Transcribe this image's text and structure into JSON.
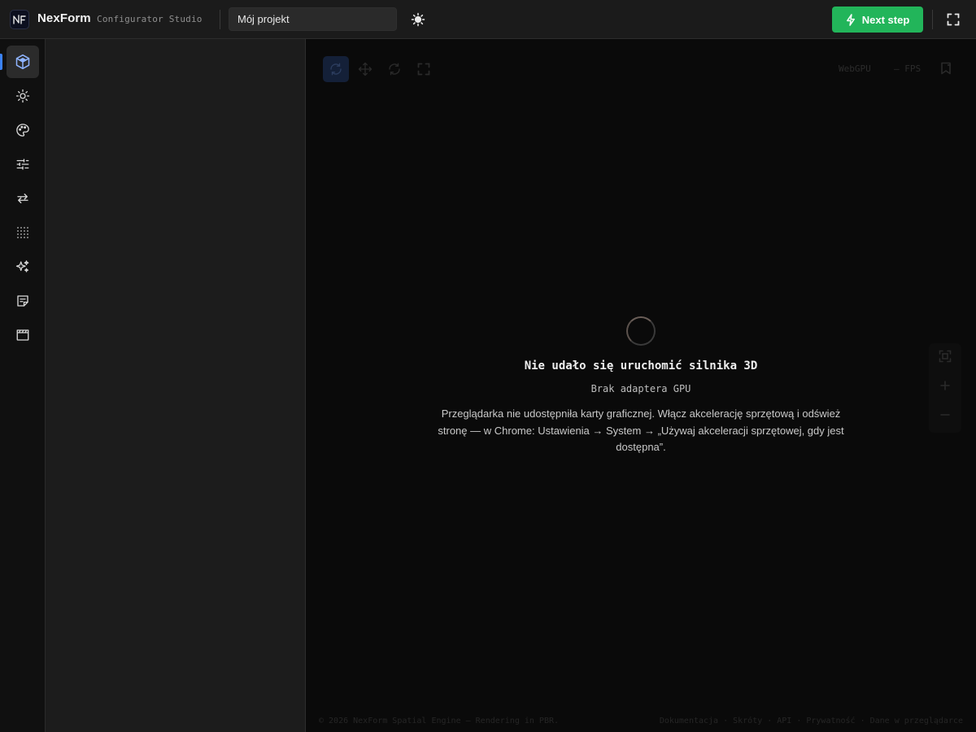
{
  "header": {
    "brand": "NexForm",
    "subtitle": "Configurator Studio",
    "project_value": "Mój projekt",
    "next_label": "Next step"
  },
  "rail": {
    "items": [
      {
        "id": "model",
        "icon": "cube-icon",
        "active": true
      },
      {
        "id": "lighting",
        "icon": "sun-icon"
      },
      {
        "id": "materials",
        "icon": "palette-icon"
      },
      {
        "id": "adjust",
        "icon": "sliders-icon"
      },
      {
        "id": "transform",
        "icon": "swap-arrows-icon"
      },
      {
        "id": "grid",
        "icon": "dot-grid-icon"
      },
      {
        "id": "effects",
        "icon": "sparkles-icon"
      },
      {
        "id": "notes",
        "icon": "note-icon"
      },
      {
        "id": "animation",
        "icon": "clapperboard-icon"
      }
    ]
  },
  "viewport": {
    "badges": {
      "renderer": "WebGPU",
      "fps": "— FPS"
    },
    "error": {
      "title": "Nie udało się uruchomić silnika 3D",
      "subtitle": "Brak adaptera GPU",
      "body": "Przeglądarka nie udostępniła karty graficznej. Włącz akcelerację sprzętową i odśwież stronę — w Chrome: Ustawienia → System → „Używaj akceleracji sprzętowej, gdy jest dostępna”."
    },
    "footer": {
      "copyright": "© 2026 NexForm Spatial Engine — Rendering in PBR.",
      "links": [
        "Dokumentacja",
        "Skróty",
        "API",
        "Prywatność",
        "Dane w przeglądarce"
      ],
      "separator": "·"
    }
  },
  "colors": {
    "accent_green": "#22b55a",
    "accent_blue": "#3b82f6"
  }
}
